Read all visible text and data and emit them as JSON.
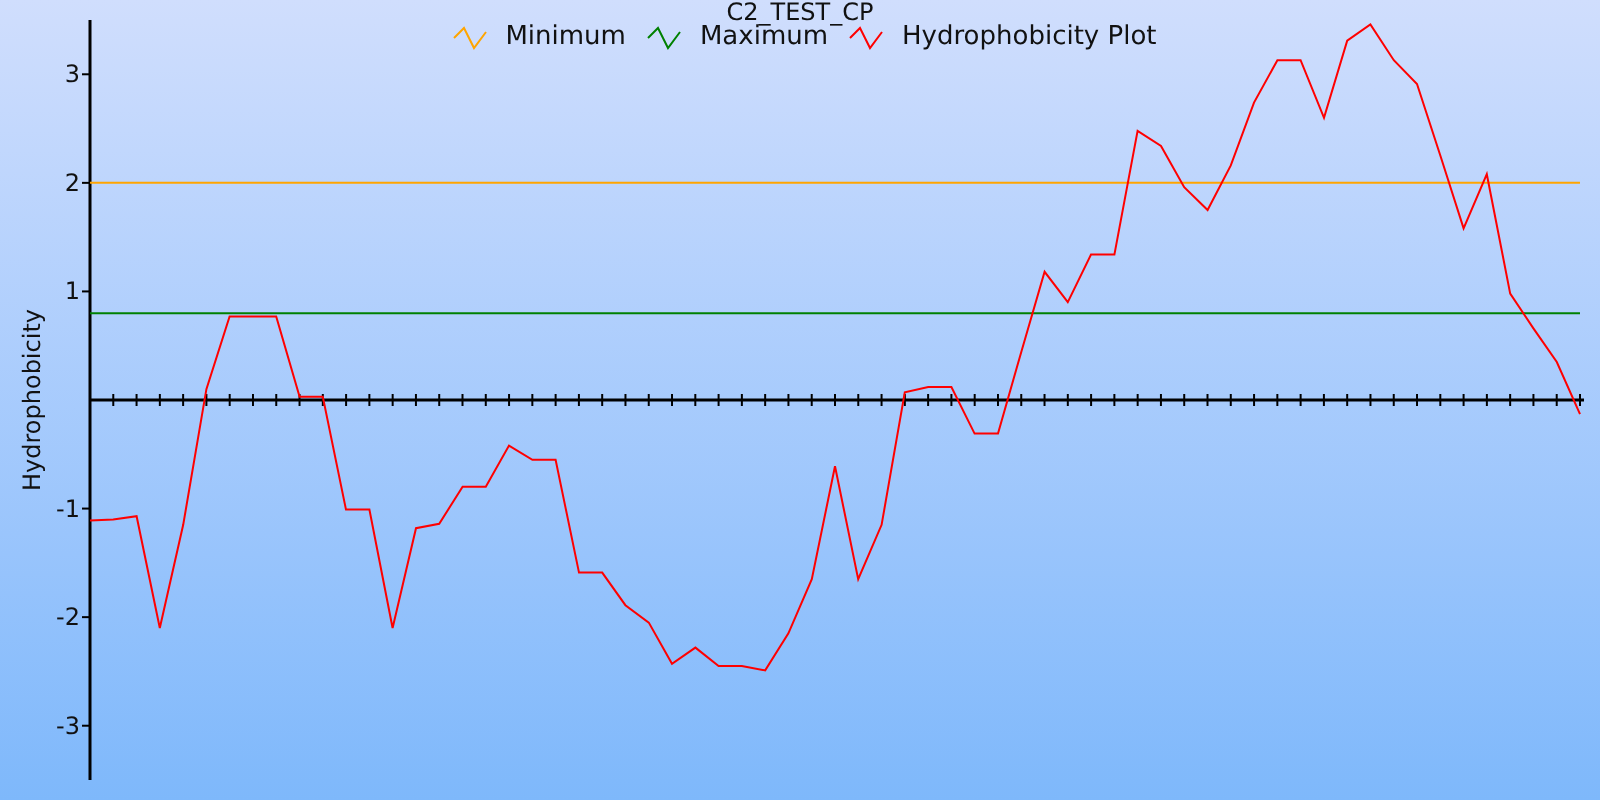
{
  "chart": {
    "chart_data": {
      "type": "line",
      "title": "C2_TEST_CP",
      "ylabel": "Hydrophobicity",
      "categories": [
        null,
        null,
        null,
        null,
        null,
        null,
        null,
        null,
        null,
        null,
        null,
        null,
        null,
        null,
        null,
        null,
        null,
        null,
        null,
        null,
        null,
        null,
        null,
        null,
        null,
        null,
        null,
        null,
        null,
        null,
        null,
        null,
        null,
        null,
        null,
        null,
        null,
        null,
        null,
        null,
        null,
        null,
        null,
        null,
        null,
        null,
        null,
        null,
        null,
        null,
        null,
        null,
        null,
        null,
        null,
        null,
        null,
        null,
        null,
        null,
        null,
        null,
        null,
        null,
        null
      ],
      "legend": "top",
      "ylim": [
        -3.5,
        3.5
      ],
      "yticks": [
        -3,
        -2,
        -1,
        1,
        2,
        3
      ],
      "series": [
        {
          "name": "Minimum",
          "color": "#ffa500",
          "values": [
            2,
            2,
            2,
            2,
            2,
            2,
            2,
            2,
            2,
            2,
            2,
            2,
            2,
            2,
            2,
            2,
            2,
            2,
            2,
            2,
            2,
            2,
            2,
            2,
            2,
            2,
            2,
            2,
            2,
            2,
            2,
            2,
            2,
            2,
            2,
            2,
            2,
            2,
            2,
            2,
            2,
            2,
            2,
            2,
            2,
            2,
            2,
            2,
            2,
            2,
            2,
            2,
            2,
            2,
            2,
            2,
            2,
            2,
            2,
            2,
            2,
            2,
            2,
            2,
            2
          ]
        },
        {
          "name": "Maximum",
          "color": "#008000",
          "values": [
            0.8,
            0.8,
            0.8,
            0.8,
            0.8,
            0.8,
            0.8,
            0.8,
            0.8,
            0.8,
            0.8,
            0.8,
            0.8,
            0.8,
            0.8,
            0.8,
            0.8,
            0.8,
            0.8,
            0.8,
            0.8,
            0.8,
            0.8,
            0.8,
            0.8,
            0.8,
            0.8,
            0.8,
            0.8,
            0.8,
            0.8,
            0.8,
            0.8,
            0.8,
            0.8,
            0.8,
            0.8,
            0.8,
            0.8,
            0.8,
            0.8,
            0.8,
            0.8,
            0.8,
            0.8,
            0.8,
            0.8,
            0.8,
            0.8,
            0.8,
            0.8,
            0.8,
            0.8,
            0.8,
            0.8,
            0.8,
            0.8,
            0.8,
            0.8,
            0.8,
            0.8,
            0.8,
            0.8,
            0.8,
            0.8
          ]
        },
        {
          "name": "Hydrophobicity Plot",
          "color": "#ff0000",
          "values": [
            -1.11,
            -1.1,
            -1.07,
            -2.1,
            -1.15,
            0.1,
            0.77,
            0.77,
            0.77,
            0.03,
            0.03,
            -1.01,
            -1.01,
            -2.1,
            -1.18,
            -1.14,
            -0.8,
            -0.8,
            -0.42,
            -0.55,
            -0.55,
            -1.59,
            -1.59,
            -1.89,
            -2.05,
            -2.43,
            -2.28,
            -2.45,
            -2.45,
            -2.49,
            -2.15,
            -1.65,
            -0.61,
            -1.65,
            -1.15,
            0.07,
            0.12,
            0.12,
            -0.31,
            -0.31,
            0.44,
            1.18,
            0.9,
            1.34,
            1.34,
            2.48,
            2.34,
            1.96,
            1.75,
            2.16,
            2.74,
            3.13,
            3.13,
            2.6,
            3.31,
            3.46,
            3.13,
            2.91,
            2.25,
            1.58,
            2.08,
            0.98,
            0.66,
            0.35,
            -0.13
          ]
        }
      ]
    }
  }
}
